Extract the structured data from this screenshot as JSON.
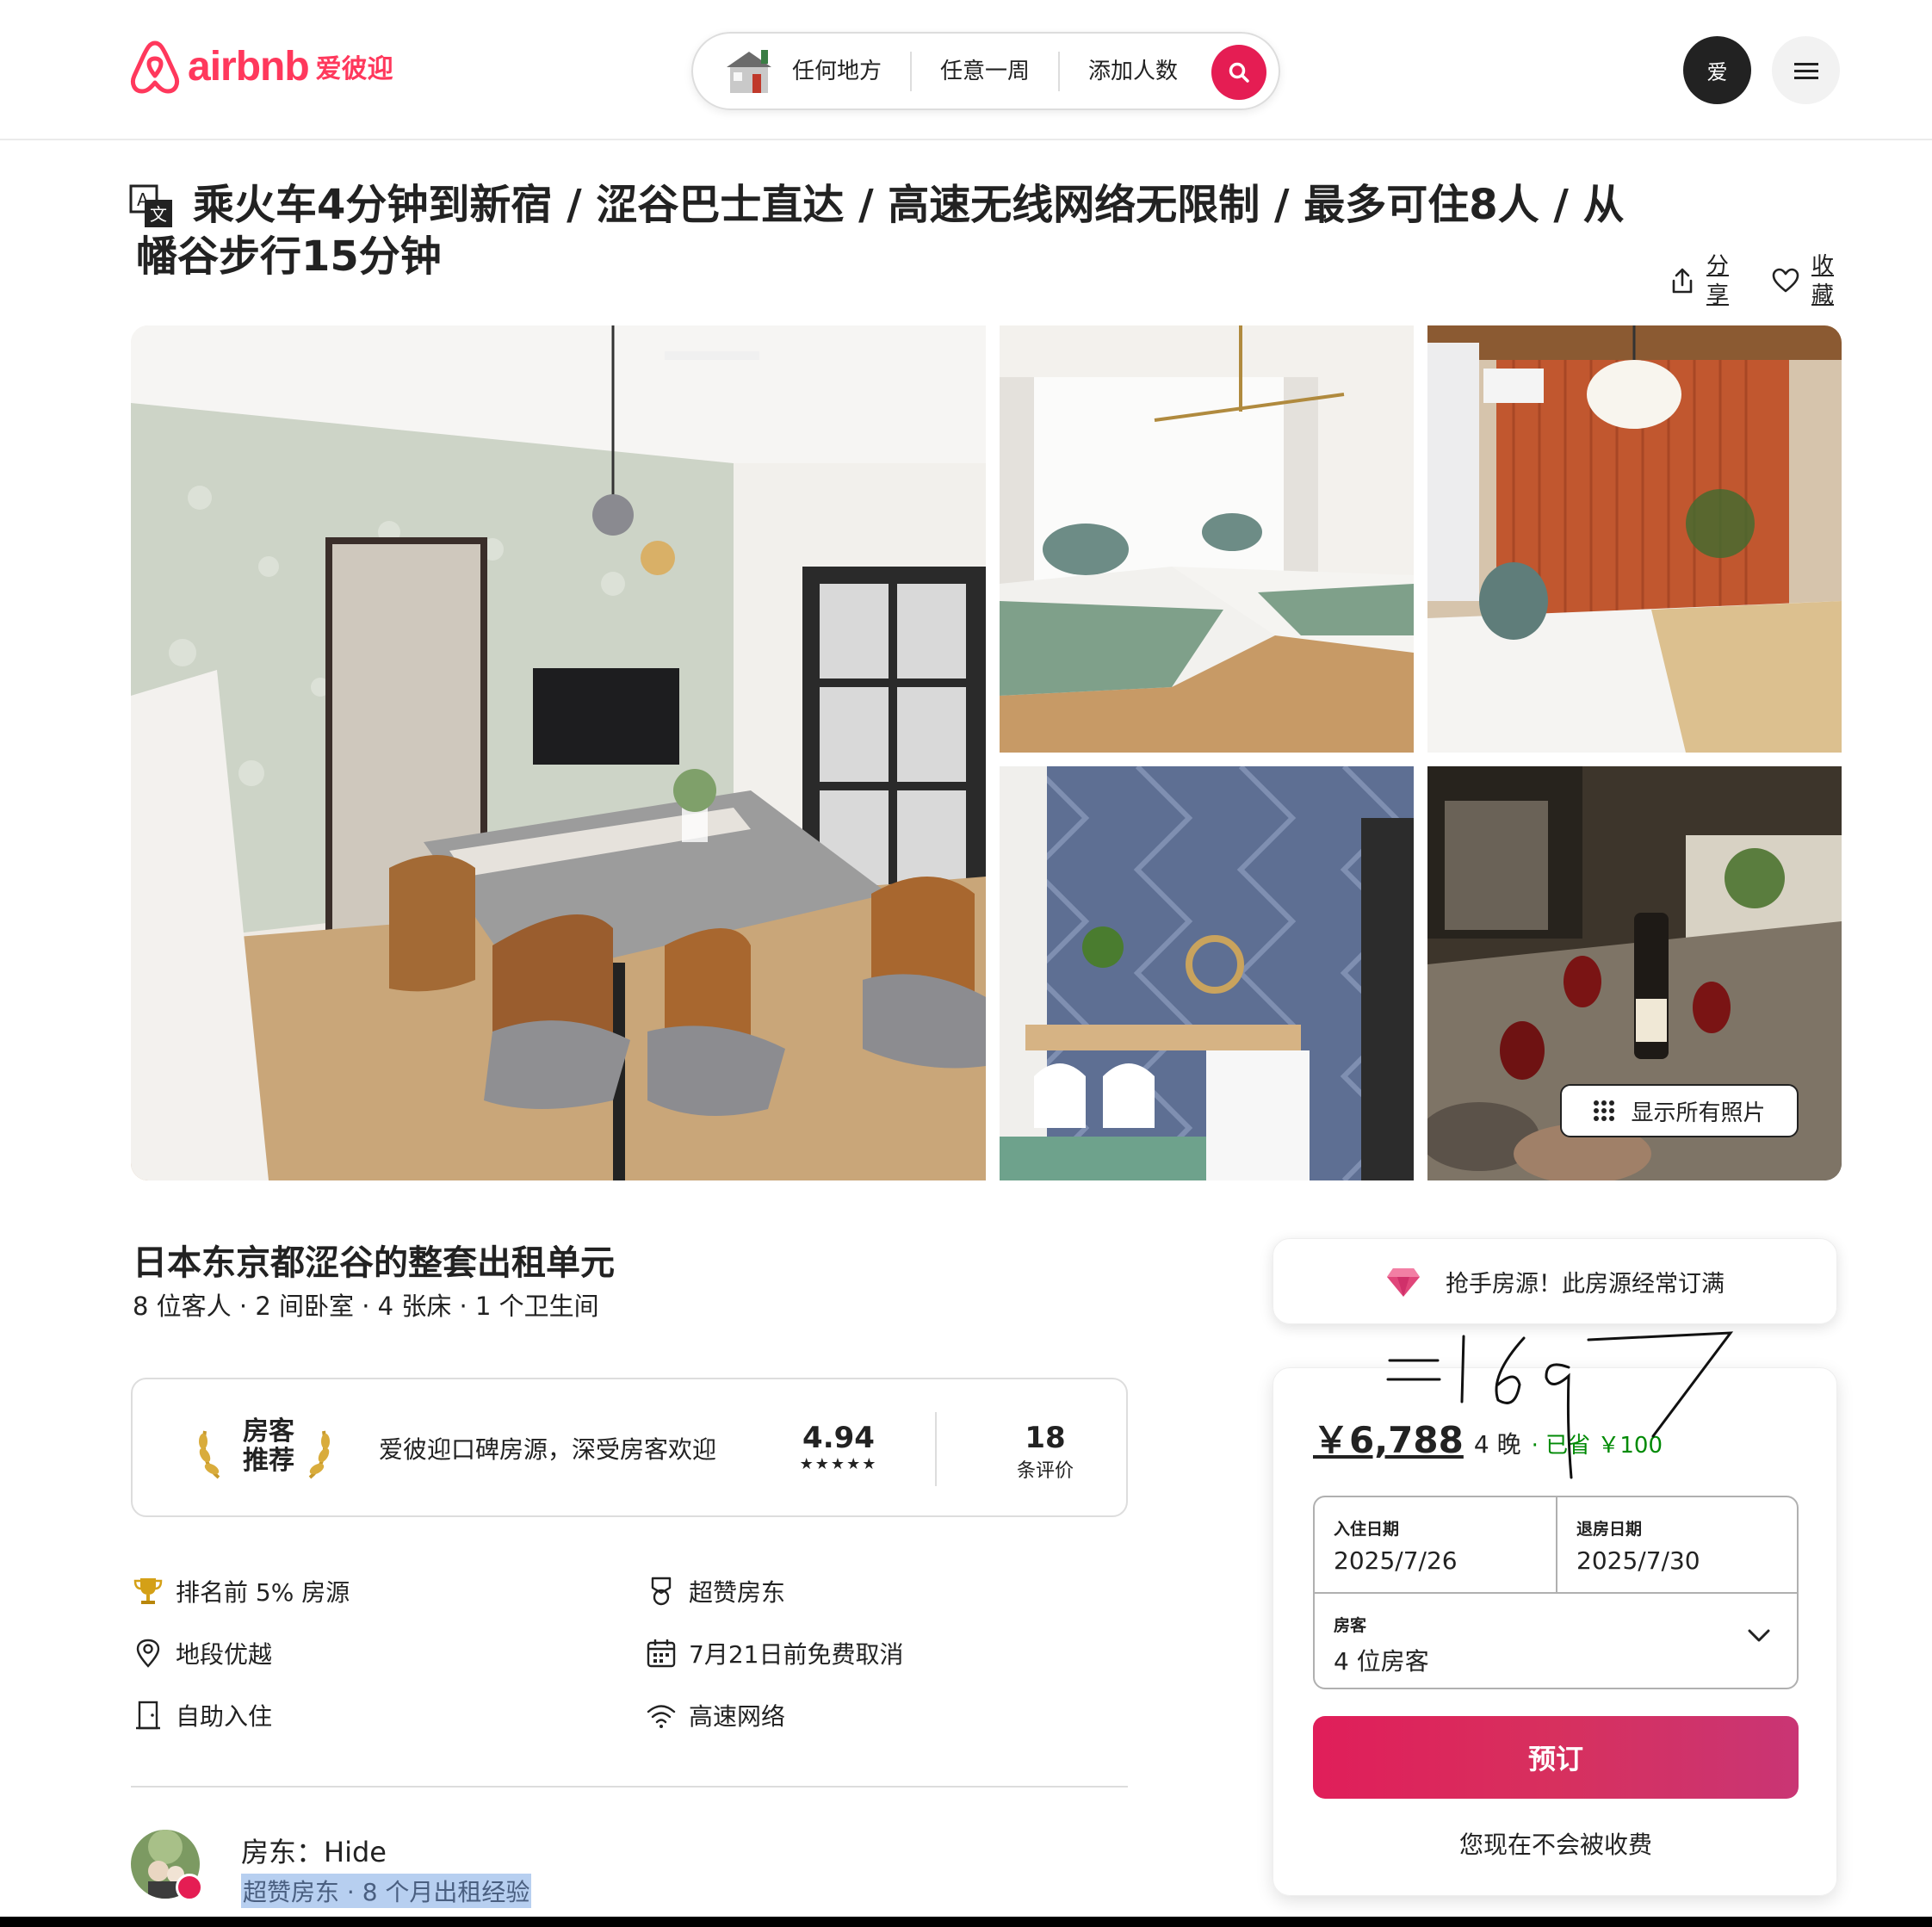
{
  "header": {
    "logo_text": "airbnb",
    "logo_cn": "爱彼迎",
    "search_where": "任何地方",
    "search_when": "任意一周",
    "search_who": "添加人数",
    "avatar_letter": "爱"
  },
  "listing": {
    "title": "乘火车4分钟到新宿 / 涩谷巴士直达 / 高速无线网络无限制 / 最多可住8人 / 从幡谷步行15分钟",
    "share_label": "分享",
    "save_label": "收藏",
    "show_all_photos": "显示所有照片",
    "subtitle": "日本东京都涩谷的整套出租单元",
    "specs": "8 位客人 · 2 间卧室 · 4 张床 · 1 个卫生间"
  },
  "rating_card": {
    "badge_line1": "房客",
    "badge_line2": "推荐",
    "description": "爱彼迎口碑房源，深受房客欢迎",
    "score": "4.94",
    "stars": "★★★★★",
    "reviews_count": "18",
    "reviews_label": "条评价"
  },
  "features": [
    {
      "icon": "trophy-icon",
      "label": "排名前 5% 房源"
    },
    {
      "icon": "superhost-medal-icon",
      "label": "超赞房东"
    },
    {
      "icon": "location-pin-icon",
      "label": "地段优越"
    },
    {
      "icon": "calendar-icon",
      "label": "7月21日前免费取消"
    },
    {
      "icon": "door-icon",
      "label": "自助入住"
    },
    {
      "icon": "wifi-icon",
      "label": "高速网络"
    }
  ],
  "host": {
    "name_line": "房东：Hide",
    "sub_line": "超赞房东 · 8 个月出租经验"
  },
  "booking": {
    "rare_find": "抢手房源！此房源经常订满",
    "price": "￥6,788",
    "nights": "4 晚",
    "saved": "· 已省 ￥100",
    "checkin_label": "入住日期",
    "checkin_value": "2025/7/26",
    "checkout_label": "退房日期",
    "checkout_value": "2025/7/30",
    "guests_label": "房客",
    "guests_value": "4 位房客",
    "reserve_label": "预订",
    "no_charge": "您现在不会被收费",
    "handwriting": "=1697"
  },
  "colors": {
    "brand": "#ff385c",
    "reserve": "#d7305e",
    "saved_green": "#008a05"
  }
}
